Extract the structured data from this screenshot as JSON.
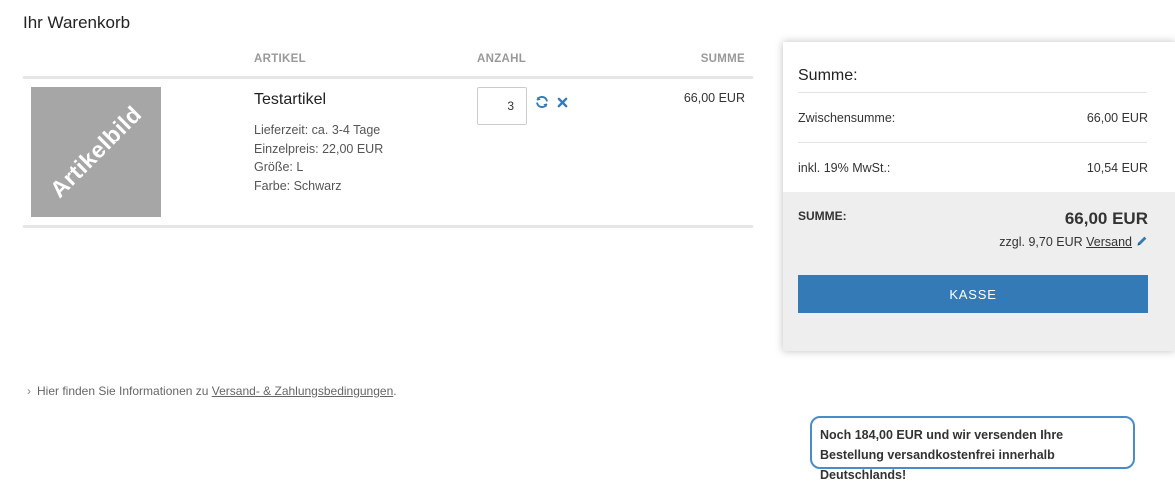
{
  "page": {
    "title": "Ihr Warenkorb"
  },
  "cart": {
    "headers": {
      "article": "ARTIKEL",
      "quantity": "ANZAHL",
      "sum": "SUMME"
    },
    "items": [
      {
        "image_label": "Artikelbild",
        "name": "Testartikel",
        "attributes": [
          "Lieferzeit: ca. 3-4 Tage",
          "Einzelpreis: 22,00 EUR",
          "Größe: L",
          "Farbe: Schwarz"
        ],
        "quantity": "3",
        "total": "66,00 EUR"
      }
    ]
  },
  "info": {
    "prefix": "Hier finden Sie Informationen zu",
    "link": "Versand- & Zahlungsbedingungen",
    "suffix": "."
  },
  "summary": {
    "title": "Summe:",
    "subtotal_label": "Zwischensumme:",
    "subtotal_value": "66,00 EUR",
    "tax_label": "inkl. 19% MwSt.:",
    "tax_value": "10,54 EUR",
    "total_label": "SUMME:",
    "total_value": "66,00 EUR",
    "shipping_prefix": "zzgl. 9,70 EUR",
    "shipping_link": "Versand",
    "checkout_label": "KASSE"
  },
  "free_shipping_notice": "Noch 184,00 EUR und wir versenden Ihre Bestellung versandkostenfrei innerhalb Deutschlands!",
  "colors": {
    "accent": "#337ab7",
    "notice_border": "#4a8cc9",
    "icon_blue": "#337ab7"
  }
}
